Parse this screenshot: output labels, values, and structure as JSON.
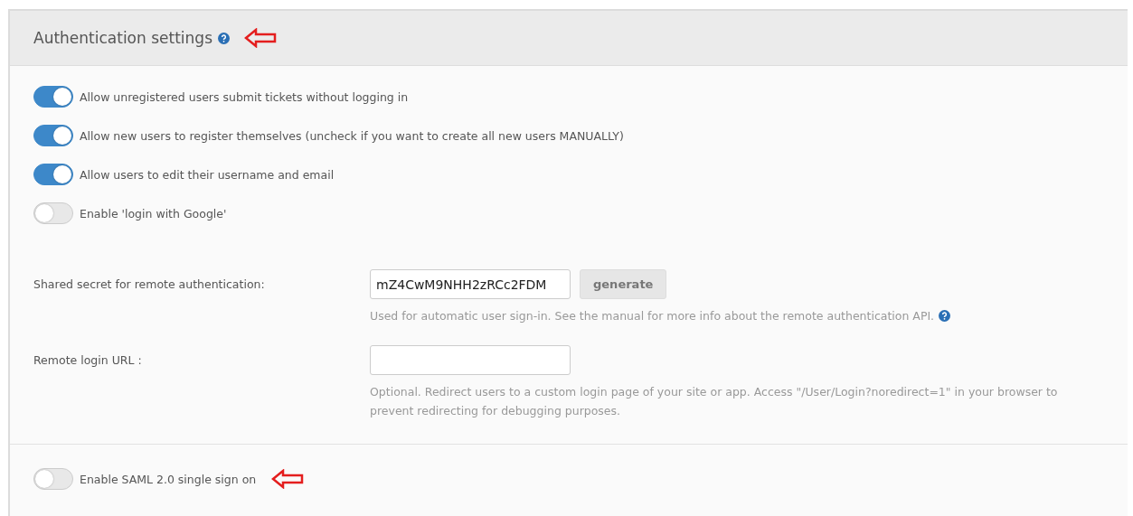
{
  "panel": {
    "title": "Authentication settings"
  },
  "toggles": [
    {
      "label": "Allow unregistered users submit tickets without logging in",
      "on": true
    },
    {
      "label": "Allow new users to register themselves (uncheck if you want to create all new users MANUALLY)",
      "on": true
    },
    {
      "label": "Allow users to edit their username and email",
      "on": true
    },
    {
      "label": "Enable 'login with Google'",
      "on": false
    }
  ],
  "fields": [
    {
      "label": "Shared secret for remote authentication:",
      "value": "mZ4CwM9NHH2zRCc2FDM",
      "button": "generate",
      "hint": "Used for automatic user sign-in. See the manual for more info about the remote authentication API.",
      "help": true
    },
    {
      "label": "Remote login URL :",
      "hint": "Optional. Redirect users to a custom login page of your site or app. Access \"/User/Login?noredirect=1\" in your browser to prevent redirecting for debugging purposes.",
      "help": false
    }
  ],
  "saml": {
    "label": "Enable SAML 2.0 single sign on",
    "on": false
  }
}
